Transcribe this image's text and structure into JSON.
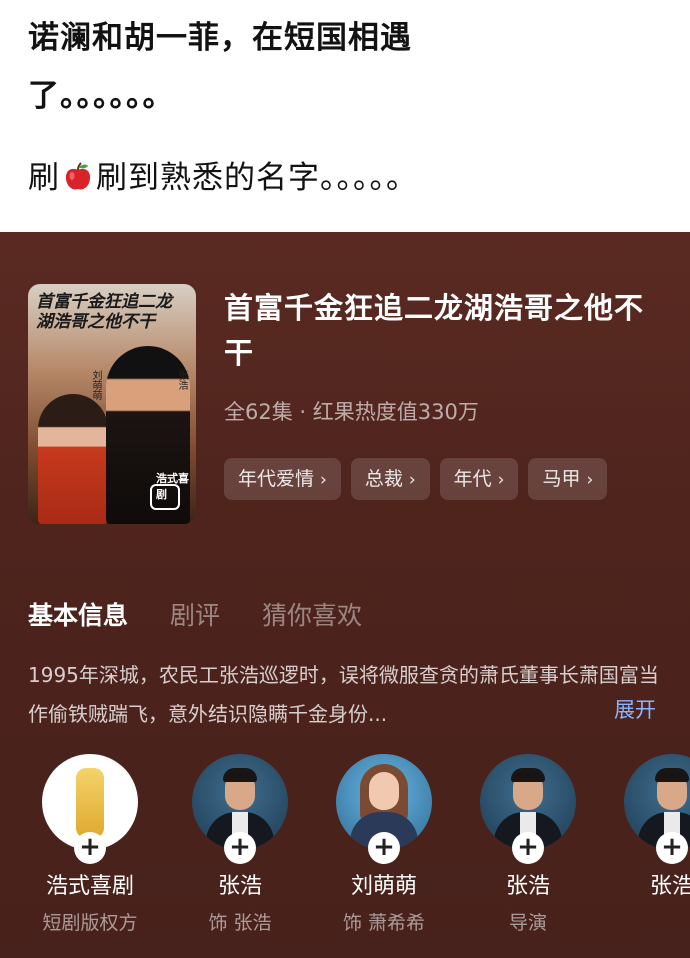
{
  "post": {
    "line1": "诺澜和胡一菲，在短国相遇",
    "line2": "了。。。。。。",
    "line3_before": "刷",
    "line3_after": "刷到熟悉的名字。。。。。",
    "apple_icon": "red-apple-emoji"
  },
  "show": {
    "poster": {
      "title_text": "首富千金狂追二龙湖浩哥之他不干",
      "actor_a": "刘萌萌",
      "actor_b": "张浩",
      "badge": "浩式喜剧"
    },
    "title": "首富千金狂追二龙湖浩哥之他不干",
    "meta": "全62集 · 红果热度值330万",
    "tags": [
      {
        "label": "年代爱情"
      },
      {
        "label": "总裁"
      },
      {
        "label": "年代"
      },
      {
        "label": "马甲"
      }
    ],
    "chevron": "›"
  },
  "tabs": [
    "基本信息",
    "剧评",
    "猜你喜欢"
  ],
  "synopsis": "1995年深城，农民工张浩巡逻时，误将微服查贪的萧氏董事长萧国富当作偷铁贼踹飞，意外结识隐瞒千金身份...",
  "expand_label": "展开",
  "cast": [
    {
      "name": "浩式喜剧",
      "role": "短剧版权方"
    },
    {
      "name": "张浩",
      "role": "饰 张浩"
    },
    {
      "name": "刘萌萌",
      "role": "饰 萧希希"
    },
    {
      "name": "张浩",
      "role": "导演"
    },
    {
      "name": "张浩",
      "role": ""
    }
  ],
  "colors": {
    "card_bg": "#4e241d",
    "link": "#8ab4ff"
  }
}
